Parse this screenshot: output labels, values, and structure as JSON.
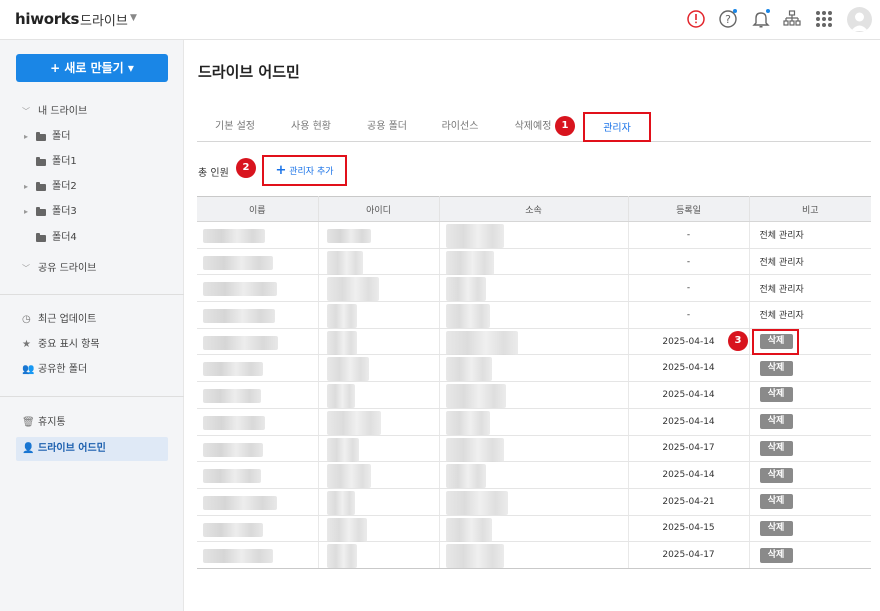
{
  "topbar": {
    "logo": "hiworks",
    "app_name": "드라이브",
    "icons": [
      "alert-circle-icon",
      "help-icon",
      "bell-icon",
      "org-chart-icon",
      "apps-grid-icon",
      "avatar"
    ]
  },
  "sidebar": {
    "new_button": "+ 새로 만들기 ▾",
    "my_drive": "내 드라이브",
    "folders": [
      "폴더",
      "폴더1",
      "폴더2",
      "폴더3",
      "폴더4"
    ],
    "shared_drive": "공유 드라이브",
    "recent": "최근 업데이트",
    "starred": "중요 표시 항목",
    "shared_folders": "공유한 폴더",
    "trash": "휴지통",
    "drive_admin": "드라이브 어드민"
  },
  "main": {
    "title": "드라이브 어드민",
    "tabs": [
      "기본 설정",
      "사용 현황",
      "공용 폴더",
      "라이선스",
      "삭제예정",
      "관리자"
    ],
    "active_tab": "관리자",
    "total_label": "총 인원",
    "add_admin": "관리자 추가",
    "markers": [
      "1",
      "2",
      "3"
    ]
  },
  "table": {
    "headers": [
      "이름",
      "아이디",
      "소속",
      "등록일",
      "비고"
    ],
    "rows": [
      {
        "date": "-",
        "note": "전체 관리자"
      },
      {
        "date": "-",
        "note": "전체 관리자"
      },
      {
        "date": "-",
        "note": "전체 관리자"
      },
      {
        "date": "-",
        "note": "전체 관리자"
      },
      {
        "date": "2025-04-14",
        "note": "삭제"
      },
      {
        "date": "2025-04-14",
        "note": "삭제"
      },
      {
        "date": "2025-04-14",
        "note": "삭제"
      },
      {
        "date": "2025-04-14",
        "note": "삭제"
      },
      {
        "date": "2025-04-17",
        "note": "삭제"
      },
      {
        "date": "2025-04-14",
        "note": "삭제"
      },
      {
        "date": "2025-04-21",
        "note": "삭제"
      },
      {
        "date": "2025-04-15",
        "note": "삭제"
      },
      {
        "date": "2025-04-17",
        "note": "삭제"
      }
    ]
  },
  "colors": {
    "primary": "#1a86e6",
    "highlight_red": "#e1101a",
    "active_tab_text": "#1a73e8",
    "delete_button": "#8a8a8a",
    "sidebar_bg": "#f4f5f7"
  }
}
